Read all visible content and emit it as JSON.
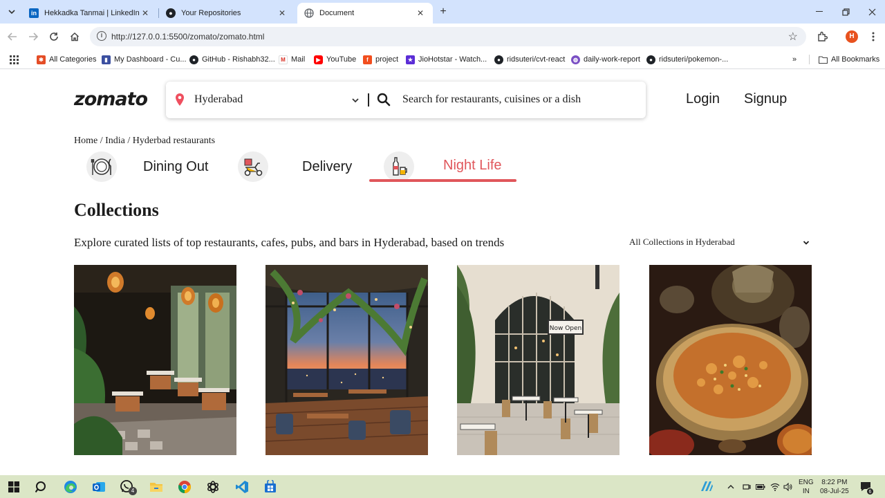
{
  "browser": {
    "tabs": [
      {
        "title": "Hekkadka Tanmai | LinkedIn",
        "favicon": "linkedin-icon",
        "color": "#0a66c2"
      },
      {
        "title": "Your Repositories",
        "favicon": "github-icon",
        "color": "#1f2328"
      },
      {
        "title": "Document",
        "favicon": "globe-icon",
        "color": "#5f6368"
      }
    ],
    "url": "http://127.0.0.1:5500/zomato/zomato.html",
    "profile_initial": "H",
    "bookmarks": [
      {
        "label": "All Categories",
        "icon": "joomla-icon"
      },
      {
        "label": "My Dashboard - Cu...",
        "icon": "bookmark-icon"
      },
      {
        "label": "GitHub - Rishabh32...",
        "icon": "github-icon"
      },
      {
        "label": "Mail",
        "icon": "gmail-icon"
      },
      {
        "label": "YouTube",
        "icon": "youtube-icon"
      },
      {
        "label": "project",
        "icon": "figma-icon"
      },
      {
        "label": "JioHotstar - Watch...",
        "icon": "hotstar-icon"
      },
      {
        "label": "ridsuteri/cvt-react",
        "icon": "github-icon"
      },
      {
        "label": "daily-work-report",
        "icon": "globe-icon"
      },
      {
        "label": "ridsuteri/pokemon-...",
        "icon": "github-icon"
      }
    ],
    "all_bookmarks": "All Bookmarks"
  },
  "page": {
    "logo": "zomato",
    "location": "Hyderabad",
    "search_placeholder": "Search for restaurants, cuisines or a dish",
    "login": "Login",
    "signup": "Signup",
    "breadcrumb": "Home / India / Hyderbad restaurants",
    "categories": [
      {
        "label": "Dining Out",
        "icon": "dining-icon"
      },
      {
        "label": "Delivery",
        "icon": "delivery-scooter-icon"
      },
      {
        "label": "Night Life",
        "icon": "nightlife-drinks-icon",
        "active": true
      }
    ],
    "collections_title": "Collections",
    "collections_subtitle": "Explore curated lists of top restaurants, cafes, pubs, and bars in Hyderabad, based on trends",
    "collections_link": "All Collections in Hyderabad",
    "cards": [
      {
        "name": "collection-card-1",
        "sign": ""
      },
      {
        "name": "collection-card-2",
        "sign": ""
      },
      {
        "name": "collection-card-3",
        "sign": "Now Open"
      },
      {
        "name": "collection-card-4",
        "sign": ""
      }
    ],
    "accent": "#e0565b"
  },
  "taskbar": {
    "whatsapp_badge": "4",
    "lang_1": "ENG",
    "lang_2": "IN",
    "time": "8:22 PM",
    "date": "08-Jul-25",
    "notif_count": "6"
  }
}
